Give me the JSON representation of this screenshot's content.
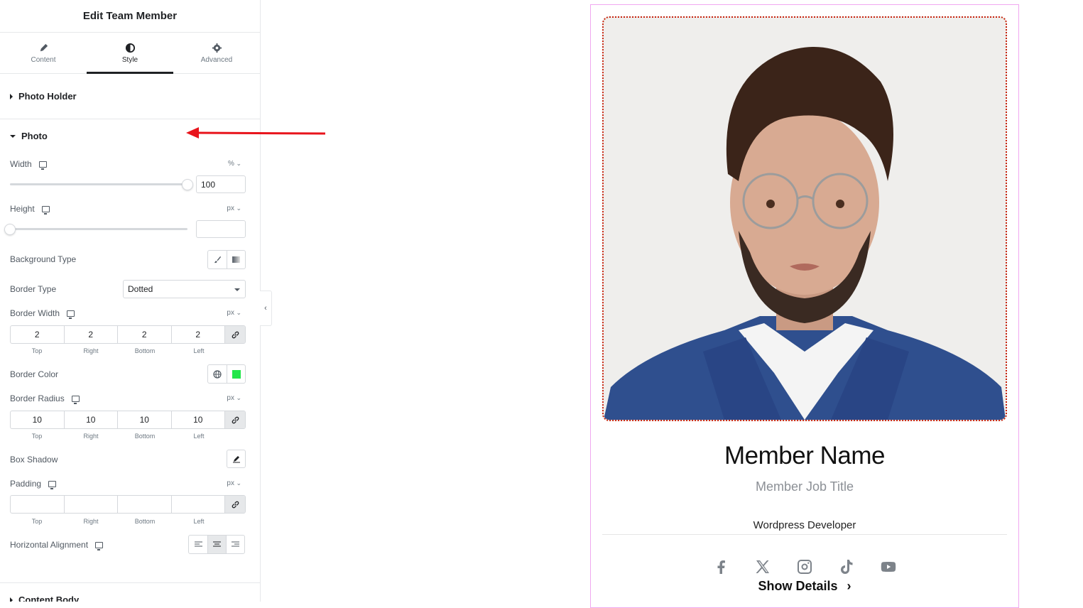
{
  "panel": {
    "title": "Edit Team Member",
    "tabs": [
      {
        "label": "Content",
        "icon": "pencil-icon"
      },
      {
        "label": "Style",
        "icon": "contrast-icon",
        "active": true
      },
      {
        "label": "Advanced",
        "icon": "gear-icon"
      }
    ],
    "sections": {
      "photo_holder": "Photo Holder",
      "photo": "Photo",
      "content_body": "Content Body"
    },
    "controls": {
      "width": {
        "label": "Width",
        "unit": "%",
        "value": "100",
        "slider_fraction": 1.0
      },
      "height": {
        "label": "Height",
        "unit": "px",
        "value": "",
        "slider_fraction": 0.0
      },
      "background_type": {
        "label": "Background Type"
      },
      "border_type": {
        "label": "Border Type",
        "value": "Dotted"
      },
      "border_width": {
        "label": "Border Width",
        "unit": "px",
        "top": "2",
        "right": "2",
        "bottom": "2",
        "left": "2"
      },
      "border_color": {
        "label": "Border Color",
        "swatch": "#22e64a"
      },
      "border_radius": {
        "label": "Border Radius",
        "unit": "px",
        "top": "10",
        "right": "10",
        "bottom": "10",
        "left": "10"
      },
      "box_shadow": {
        "label": "Box Shadow"
      },
      "padding": {
        "label": "Padding",
        "unit": "px",
        "top": "",
        "right": "",
        "bottom": "",
        "left": ""
      },
      "horizontal_alignment": {
        "label": "Horizontal Alignment",
        "selected": "center"
      }
    },
    "dim_labels": [
      "Top",
      "Right",
      "Bottom",
      "Left"
    ]
  },
  "preview": {
    "member_name": "Member Name",
    "member_job_title": "Member Job Title",
    "description": "Wordpress Developer",
    "socials": [
      "facebook-icon",
      "x-icon",
      "instagram-icon",
      "tiktok-icon",
      "youtube-icon"
    ],
    "show_details": "Show Details",
    "accent_colors": {
      "border": "#c8240f",
      "card_outline": "#f0a8f0",
      "arrow": "#e8141c"
    }
  }
}
